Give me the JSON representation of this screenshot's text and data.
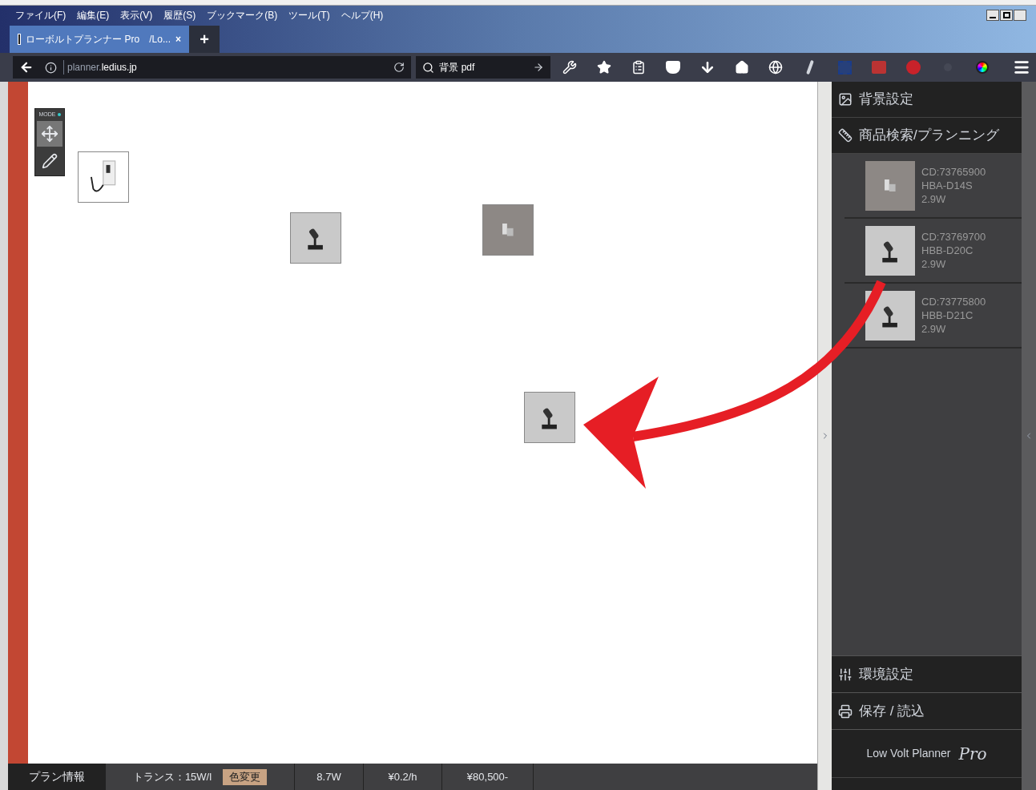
{
  "menu": [
    "ファイル(F)",
    "編集(E)",
    "表示(V)",
    "履歴(S)",
    "ブックマーク(B)",
    "ツール(T)",
    "ヘルプ(H)"
  ],
  "tab": {
    "title": "ローボルトプランナー Pro　/Lo...",
    "close": "×",
    "new_tab": "+"
  },
  "address": {
    "subdomain": "planner.",
    "domain": "ledius.jp"
  },
  "search": {
    "value": "背景 pdf"
  },
  "mode": {
    "label": "MODE",
    "tools": [
      {
        "kind": "move",
        "selected": true
      },
      {
        "kind": "pencil",
        "selected": false
      }
    ]
  },
  "canvas_items": [
    {
      "kind": "adapter"
    },
    {
      "kind": "spotlight"
    },
    {
      "kind": "wall-light"
    },
    {
      "kind": "spotlight"
    }
  ],
  "sidebar": {
    "top_sections": [
      {
        "kind": "background",
        "label": "背景設定"
      },
      {
        "kind": "search",
        "label": "商品検索/プランニング"
      }
    ],
    "products": [
      {
        "kind": "wall-light",
        "code": "CD:73765900",
        "model": "HBA-D14S",
        "watt": "2.9W"
      },
      {
        "kind": "spotlight",
        "code": "CD:73769700",
        "model": "HBB-D20C",
        "watt": "2.9W"
      },
      {
        "kind": "spotlight",
        "code": "CD:73775800",
        "model": "HBB-D21C",
        "watt": "2.9W"
      }
    ],
    "bottom_sections": [
      {
        "kind": "settings",
        "label": "環境設定"
      },
      {
        "kind": "save",
        "label": "保存 / 読込"
      }
    ],
    "logo": {
      "name": "Low Volt Planner",
      "suffix": "Pro"
    }
  },
  "status_bar": {
    "plan_info": "プラン情報",
    "trans": "トランス：15W/l",
    "color_button": "色変更",
    "power": "8.7W",
    "cost_rate": "¥0.2/h",
    "price": "¥80,500-"
  }
}
